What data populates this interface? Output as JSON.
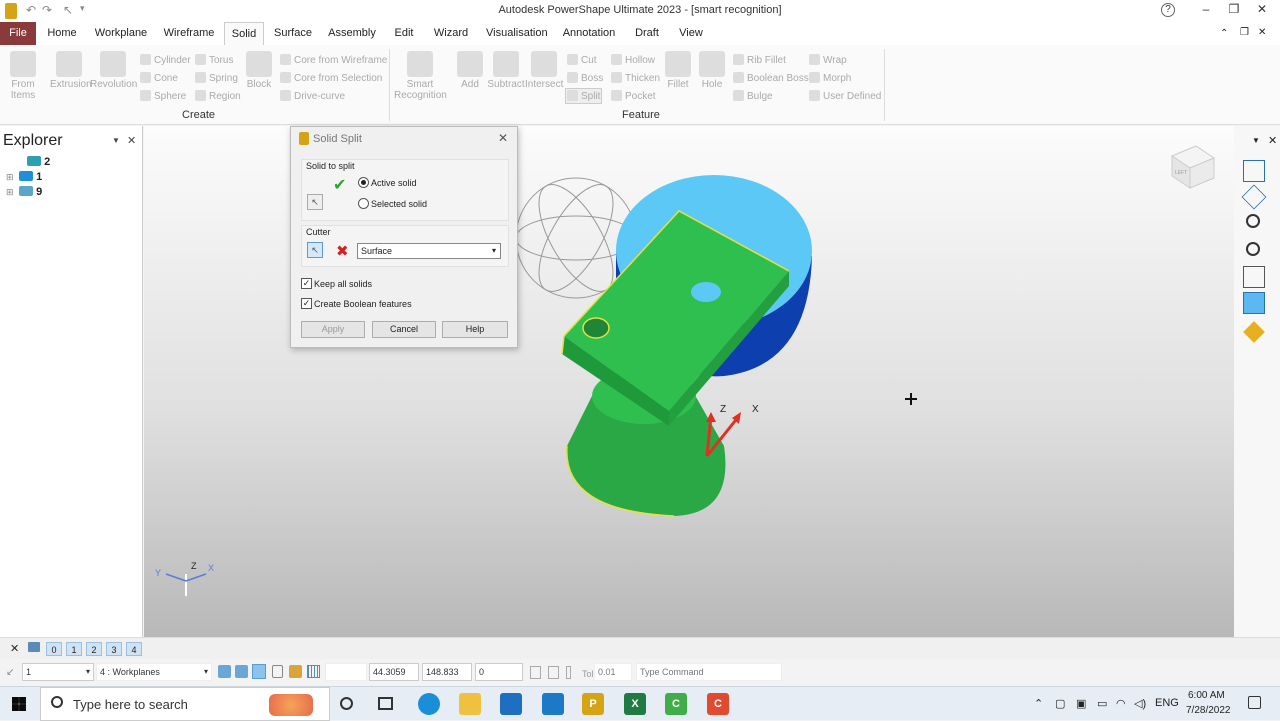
{
  "window": {
    "title": "Autodesk PowerShape Ultimate 2023 - [smart recognition]",
    "help_icon": "?",
    "minimize": "–",
    "restore": "❐",
    "close": "✕"
  },
  "menu": {
    "tabs": [
      "File",
      "Home",
      "Workplane",
      "Wireframe",
      "Solid",
      "Surface",
      "Assembly",
      "Edit",
      "Wizard",
      "Visualisation",
      "Annotation",
      "Draft",
      "View"
    ],
    "active": "Solid"
  },
  "ribbon": {
    "create": {
      "label": "Create",
      "from_items": "From Items",
      "extrusion": "Extrusion",
      "revolution": "Revolution",
      "cylinder": "Cylinder",
      "torus": "Torus",
      "cone": "Cone",
      "spring": "Spring",
      "sphere": "Sphere",
      "region": "Region",
      "block": "Block",
      "core_wireframe": "Core from Wireframe",
      "core_selection": "Core from Selection",
      "drive_curve": "Drive-curve"
    },
    "feature": {
      "label": "Feature",
      "smart_recognition": "Smart Recognition",
      "add": "Add",
      "subtract": "Subtract",
      "intersect": "Intersect",
      "cut": "Cut",
      "boss": "Boss",
      "split": "Split",
      "hollow": "Hollow",
      "thicken": "Thicken",
      "pocket": "Pocket",
      "fillet": "Fillet",
      "hole": "Hole",
      "rib_fillet": "Rib Fillet",
      "boolean_boss": "Boolean Boss",
      "bulge": "Bulge",
      "wrap": "Wrap",
      "morph": "Morph",
      "user_defined": "User Defined"
    }
  },
  "explorer": {
    "title": "Explorer",
    "items": [
      "2",
      "1",
      "9"
    ]
  },
  "dialog": {
    "title": "Solid Split",
    "solid_to_split": "Solid to split",
    "active_solid": "Active solid",
    "selected_solid": "Selected solid",
    "cutter": "Cutter",
    "cutter_value": "Surface",
    "keep_all_solids": "Keep all solids",
    "create_boolean": "Create Boolean features",
    "apply": "Apply",
    "cancel": "Cancel",
    "help": "Help"
  },
  "viewport": {
    "axis_labels": {
      "z": "Z",
      "x": "X",
      "y": "Y"
    },
    "solid_color": "#2fbf4e",
    "cylinder_top_color": "#5cc8f5",
    "cylinder_side_color": "#0e3fae",
    "cube_label": "LEFT"
  },
  "status": {
    "levels": [
      "0",
      "1",
      "2",
      "3",
      "4"
    ],
    "level_select": "1",
    "workplane_select": "4  : Workplanes",
    "x": "44.3059",
    "y": "148.833",
    "z": "0",
    "tol_label": "Tol",
    "tol": "0.01",
    "command_placeholder": "Type Command"
  },
  "taskbar": {
    "search_placeholder": "Type here to search",
    "language": "ENG",
    "time": "6:00 AM",
    "date": "7/28/2022"
  }
}
